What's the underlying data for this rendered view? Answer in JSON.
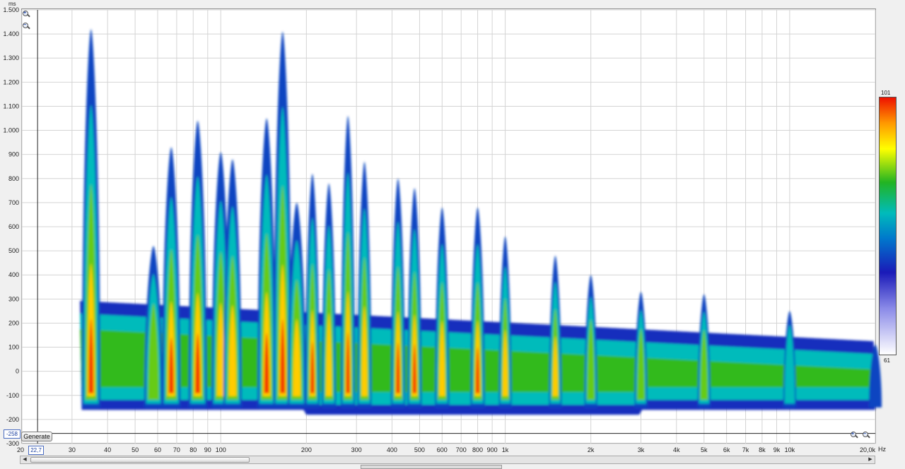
{
  "chart_data": {
    "type": "heatmap",
    "y_unit": "ms",
    "x_unit": "Hz",
    "x_scale": "log",
    "xlim": [
      20,
      20000
    ],
    "ylim": [
      -300,
      1500
    ],
    "y_ticks": [
      "1.500",
      "1.400",
      "1.300",
      "1.200",
      "1.100",
      "1.000",
      "900",
      "800",
      "700",
      "600",
      "500",
      "400",
      "300",
      "200",
      "100",
      "0",
      "-100",
      "-200",
      "-300"
    ],
    "y_tick_values": [
      1500,
      1400,
      1300,
      1200,
      1100,
      1000,
      900,
      800,
      700,
      600,
      500,
      400,
      300,
      200,
      100,
      0,
      -100,
      -200,
      -300
    ],
    "x_ticks": [
      "20",
      "30",
      "40",
      "50",
      "60",
      "70",
      "80",
      "90",
      "100",
      "200",
      "300",
      "400",
      "500",
      "600",
      "700",
      "800",
      "900",
      "1k",
      "2k",
      "3k",
      "4k",
      "5k",
      "6k",
      "7k",
      "8k",
      "9k",
      "10k",
      "20,0k"
    ],
    "x_tick_values": [
      20,
      30,
      40,
      50,
      60,
      70,
      80,
      90,
      100,
      200,
      300,
      400,
      500,
      600,
      700,
      800,
      900,
      1000,
      2000,
      3000,
      4000,
      5000,
      6000,
      7000,
      8000,
      9000,
      10000,
      20000
    ],
    "color_scale": {
      "max_label": "101",
      "min_label": "61",
      "min": 61,
      "max": 101
    },
    "grid": true,
    "legend_placement": "right",
    "colors": [
      "#ffffff",
      "#2b2bcc",
      "#00bbcc",
      "#22bb22",
      "#ffff00",
      "#ff3300"
    ],
    "ridges": [
      {
        "freq": 35,
        "top_ms": 1420,
        "peak_level": 99
      },
      {
        "freq": 58,
        "top_ms": 520,
        "peak_level": 90
      },
      {
        "freq": 67,
        "top_ms": 930,
        "peak_level": 98
      },
      {
        "freq": 83,
        "top_ms": 1040,
        "peak_level": 101
      },
      {
        "freq": 100,
        "top_ms": 910,
        "peak_level": 95
      },
      {
        "freq": 110,
        "top_ms": 880,
        "peak_level": 94
      },
      {
        "freq": 145,
        "top_ms": 1050,
        "peak_level": 101
      },
      {
        "freq": 165,
        "top_ms": 1410,
        "peak_level": 100
      },
      {
        "freq": 185,
        "top_ms": 700,
        "peak_level": 96
      },
      {
        "freq": 210,
        "top_ms": 820,
        "peak_level": 101
      },
      {
        "freq": 240,
        "top_ms": 780,
        "peak_level": 97
      },
      {
        "freq": 280,
        "top_ms": 1060,
        "peak_level": 100
      },
      {
        "freq": 320,
        "top_ms": 870,
        "peak_level": 97
      },
      {
        "freq": 420,
        "top_ms": 800,
        "peak_level": 100
      },
      {
        "freq": 480,
        "top_ms": 760,
        "peak_level": 98
      },
      {
        "freq": 600,
        "top_ms": 680,
        "peak_level": 96
      },
      {
        "freq": 800,
        "top_ms": 680,
        "peak_level": 98
      },
      {
        "freq": 1000,
        "top_ms": 560,
        "peak_level": 94
      },
      {
        "freq": 1500,
        "top_ms": 480,
        "peak_level": 93
      },
      {
        "freq": 2000,
        "top_ms": 400,
        "peak_level": 91
      },
      {
        "freq": 3000,
        "top_ms": 330,
        "peak_level": 89
      },
      {
        "freq": 5000,
        "top_ms": 320,
        "peak_level": 88
      },
      {
        "freq": 10000,
        "top_ms": 250,
        "peak_level": 85
      },
      {
        "freq": 20000,
        "top_ms": 110,
        "peak_level": 80
      }
    ]
  },
  "controls": {
    "generate_label": "Generate",
    "ymin_value": "-258",
    "xmin_value": "22,7"
  }
}
